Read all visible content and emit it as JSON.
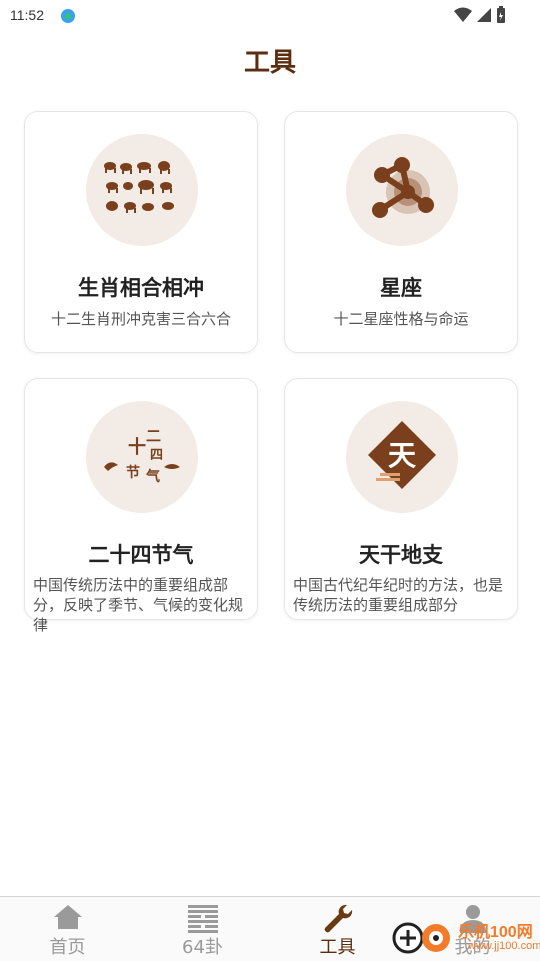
{
  "status_bar": {
    "time": "11:52"
  },
  "page": {
    "title": "工具"
  },
  "cards": [
    {
      "title": "生肖相合相冲",
      "desc": "十二生肖刑冲克害三合六合",
      "icon": "zodiac-animals-icon"
    },
    {
      "title": "星座",
      "desc": "十二星座性格与命运",
      "icon": "constellation-molecule-icon"
    },
    {
      "title": "二十四节气",
      "desc": "中国传统历法中的重要组成部分，反映了季节、气候的变化规律",
      "icon": "solar-terms-calligraphy-icon",
      "icon_text": [
        "二",
        "十",
        "四",
        "节",
        "气"
      ]
    },
    {
      "title": "天干地支",
      "desc": "中国古代纪年纪时的方法，也是传统历法的重要组成部分",
      "icon": "heavenly-stem-diamond-icon",
      "icon_text": "天"
    }
  ],
  "bottom_nav": {
    "items": [
      {
        "label": "首页",
        "icon": "home-icon",
        "active": false
      },
      {
        "label": "64卦",
        "icon": "hexagram-icon",
        "active": false
      },
      {
        "label": "工具",
        "icon": "wrench-icon",
        "active": true
      },
      {
        "label": "我的",
        "icon": "user-icon",
        "active": false
      }
    ]
  },
  "watermark": {
    "text": "乐机100网",
    "url": "www.jj100.com"
  },
  "colors": {
    "brand_brown": "#5b2e10",
    "icon_brown": "#7a3f1c",
    "circle_bg": "#f3ebe6",
    "inactive_gray": "#9a9a9a",
    "watermark_orange": "#f37b2a"
  }
}
